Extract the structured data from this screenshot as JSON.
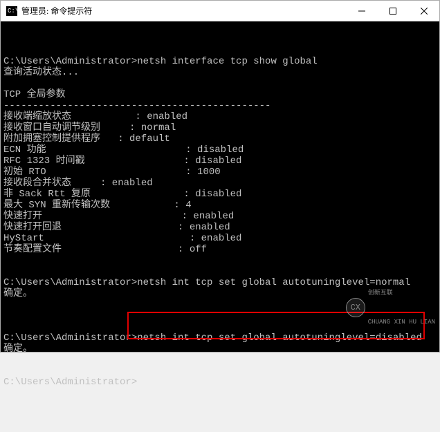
{
  "titlebar": {
    "icon_text": "C:\\.",
    "title": "管理员: 命令提示符"
  },
  "terminal": {
    "lines": [
      "",
      "C:\\Users\\Administrator>netsh interface tcp show global",
      "查询活动状态...",
      "",
      "TCP 全局参数",
      "----------------------------------------------",
      "接收端缩放状态           : enabled",
      "接收窗口自动调节级别     : normal",
      "附加拥塞控制提供程序   : default",
      "ECN 功能                        : disabled",
      "RFC 1323 时间戳                 : disabled",
      "初始 RTO                        : 1000",
      "接收段合并状态     : enabled",
      "非 Sack Rtt 复原                : disabled",
      "最大 SYN 重新传输次数           : 4",
      "快速打开                        : enabled",
      "快速打开回退                    : enabled",
      "HyStart                         : enabled",
      "节奏配置文件                    : off",
      "",
      "",
      "C:\\Users\\Administrator>netsh int tcp set global autotuninglevel=normal",
      "确定。",
      "",
      "",
      "",
      "C:\\Users\\Administrator>netsh int tcp set global autotuninglevel=disabled",
      "确定。",
      "",
      "",
      "C:\\Users\\Administrator>"
    ]
  },
  "watermark": {
    "logo_text": "CX",
    "line1": "创新互联",
    "line2": "CHUANG XIN HU LIAN"
  }
}
